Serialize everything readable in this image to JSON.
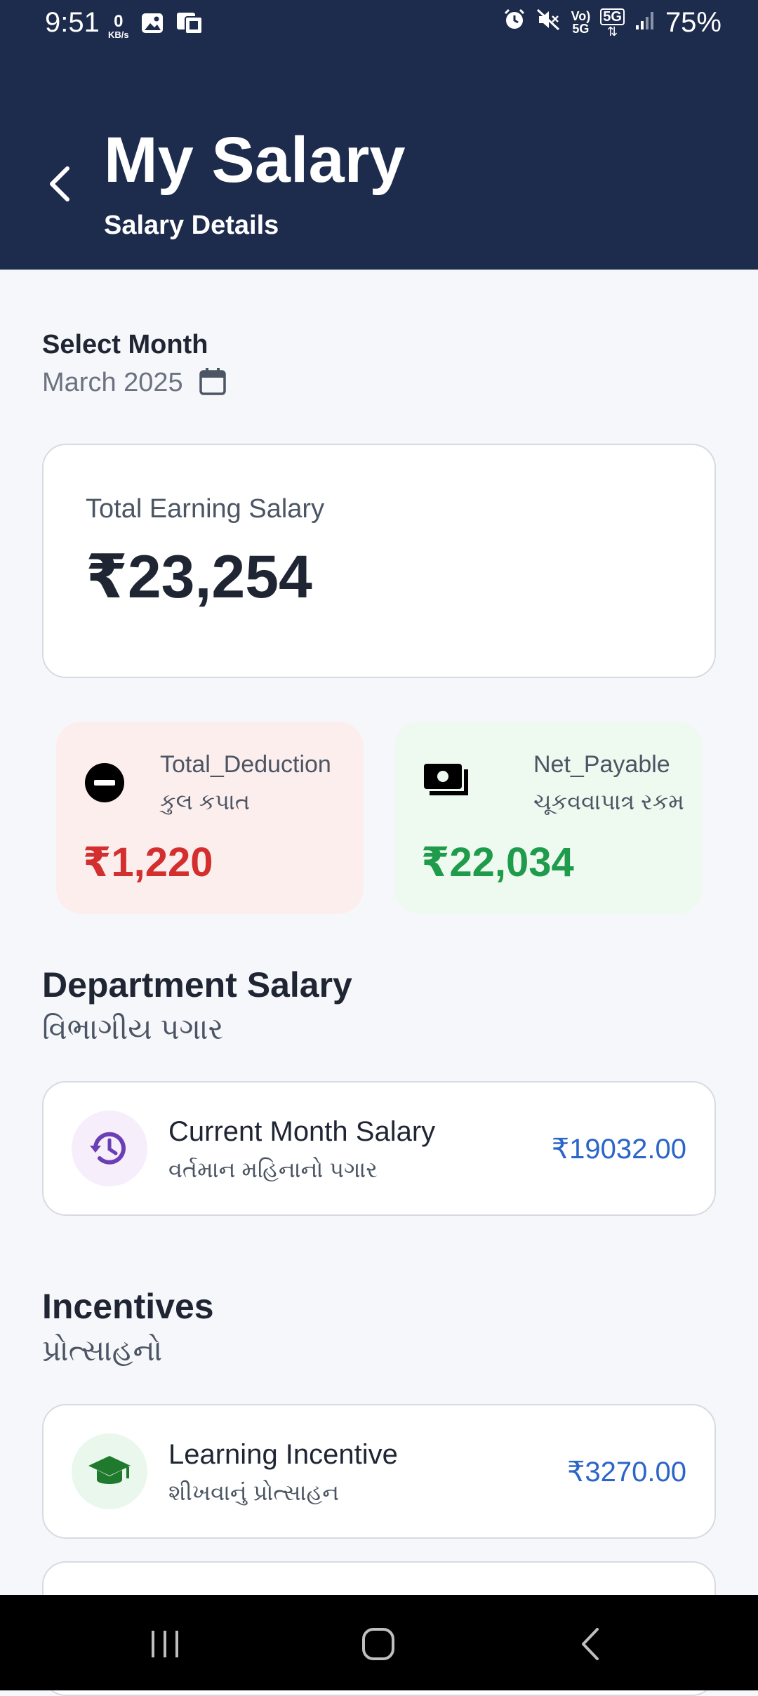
{
  "status_bar": {
    "time": "9:51",
    "net_speed": "0",
    "net_unit": "KB/s",
    "icons": [
      "image-icon",
      "sim-icon",
      "alarm-icon",
      "mute-icon",
      "volte-icon",
      "5g-icon",
      "signal-icon"
    ],
    "battery": "75%",
    "volte_label": "Vo)\n5G",
    "fiveg_label": "5G"
  },
  "header": {
    "title": "My Salary",
    "subtitle": "Salary Details",
    "bg_color": "#1d2b4c"
  },
  "month_selector": {
    "label": "Select Month",
    "value": "March 2025",
    "icon": "calendar-icon"
  },
  "total_card": {
    "label": "Total Earning Salary",
    "amount": "₹23,254"
  },
  "deduction_card": {
    "label": "Total_Deduction",
    "sublabel": "કુલ કપાત",
    "amount": "₹1,220",
    "icon": "minus-circle-icon",
    "color": "#d32f2f"
  },
  "net_card": {
    "label": "Net_Payable",
    "sublabel": "ચૂકવવાપાત્ર રકમ",
    "amount": "₹22,034",
    "icon": "cash-icon",
    "color": "#1e9c4b"
  },
  "department": {
    "title": "Department Salary",
    "subtitle": "વિભાગીય પગાર",
    "items": [
      {
        "title": "Current Month Salary",
        "subtitle": "વર્તમાન મહિનાનો પગાર",
        "amount": "₹19032.00",
        "icon": "history-icon"
      }
    ]
  },
  "incentives": {
    "title": "Incentives",
    "subtitle": "પ્રોત્સાહનો",
    "items": [
      {
        "title": "Learning Incentive",
        "subtitle": "શીખવાનું પ્રોત્સાહન",
        "amount": "₹3270.00",
        "icon": "graduation-cap-icon"
      }
    ]
  },
  "nav_bar": {
    "buttons": [
      "recents-icon",
      "home-icon",
      "back-icon"
    ]
  },
  "colors": {
    "accent_blue": "#2b65c9",
    "page_bg": "#f6f7fb"
  }
}
